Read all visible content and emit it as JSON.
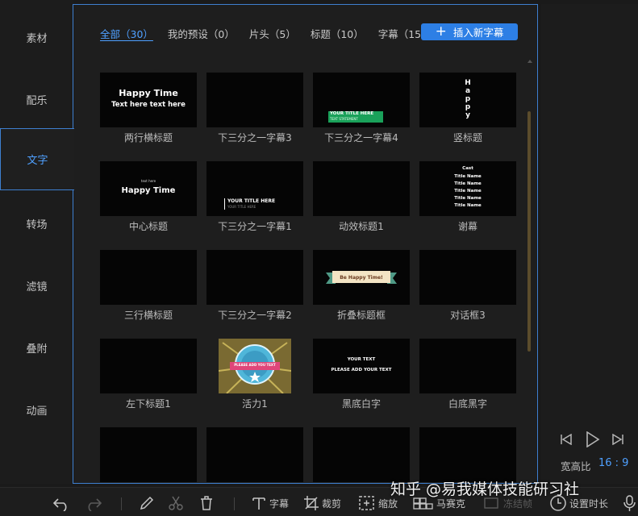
{
  "sidebar": {
    "items": [
      {
        "label": "素材"
      },
      {
        "label": "配乐"
      },
      {
        "label": "文字"
      },
      {
        "label": "转场"
      },
      {
        "label": "滤镜"
      },
      {
        "label": "叠附"
      },
      {
        "label": "动画"
      }
    ],
    "active_index": 2
  },
  "tabs": [
    {
      "label": "全部（30）"
    },
    {
      "label": "我的预设（0）"
    },
    {
      "label": "片头（5）"
    },
    {
      "label": "标题（10）"
    },
    {
      "label": "字幕（15）"
    }
  ],
  "insert_button": {
    "label": "插入新字幕",
    "icon": "plus-icon"
  },
  "templates": [
    {
      "caption": "两行横标题",
      "lines": [
        "Happy Time",
        "Text here text here"
      ]
    },
    {
      "caption": "下三分之一字幕3",
      "lines": []
    },
    {
      "caption": "下三分之一字幕4",
      "lines": [
        "YOUR TITLE HERE",
        "TEXT STATEMENT"
      ]
    },
    {
      "caption": "竖标题",
      "lines": [
        "H",
        "a",
        "p",
        "p",
        "y"
      ]
    },
    {
      "caption": "中心标题",
      "lines": [
        "text here",
        "Happy Time"
      ]
    },
    {
      "caption": "下三分之一字幕1",
      "lines": [
        "YOUR TITLE HERE",
        "YOUR TITLE HERE"
      ]
    },
    {
      "caption": "动效标题1",
      "lines": []
    },
    {
      "caption": "谢幕",
      "lines": [
        "Cast",
        "Title Name",
        "Title Name",
        "Title Name",
        "Title Name",
        "Title Name"
      ]
    },
    {
      "caption": "三行横标题",
      "lines": []
    },
    {
      "caption": "下三分之一字幕2",
      "lines": []
    },
    {
      "caption": "折叠标题框",
      "lines": [
        "Be Happy Time!"
      ]
    },
    {
      "caption": "对话框3",
      "lines": []
    },
    {
      "caption": "左下标题1",
      "lines": []
    },
    {
      "caption": "活力1",
      "lines": [
        "PLEASE ADD YOU TEXT"
      ]
    },
    {
      "caption": "黑底白字",
      "lines": [
        "YOUR TEXT",
        "PLEASE ADD YOUR TEXT"
      ]
    },
    {
      "caption": "白底黑字",
      "lines": []
    },
    {
      "caption": "",
      "lines": []
    },
    {
      "caption": "",
      "lines": []
    },
    {
      "caption": "",
      "lines": []
    },
    {
      "caption": "",
      "lines": []
    }
  ],
  "preview": {
    "aspect_label": "宽高比",
    "aspect_value": "16 : 9"
  },
  "toolbar": {
    "subtitle": "字幕",
    "crop": "裁剪",
    "zoom": "缩放",
    "mosaic": "马赛克",
    "freeze": "冻结帧",
    "duration": "设置时长"
  },
  "watermark": "知乎 @易我媒体技能研习社",
  "colors": {
    "accent": "#2d7fe5",
    "active_text": "#4fa0ff",
    "border": "#3e7fd0",
    "scrollbar": "#5b4c2c"
  }
}
